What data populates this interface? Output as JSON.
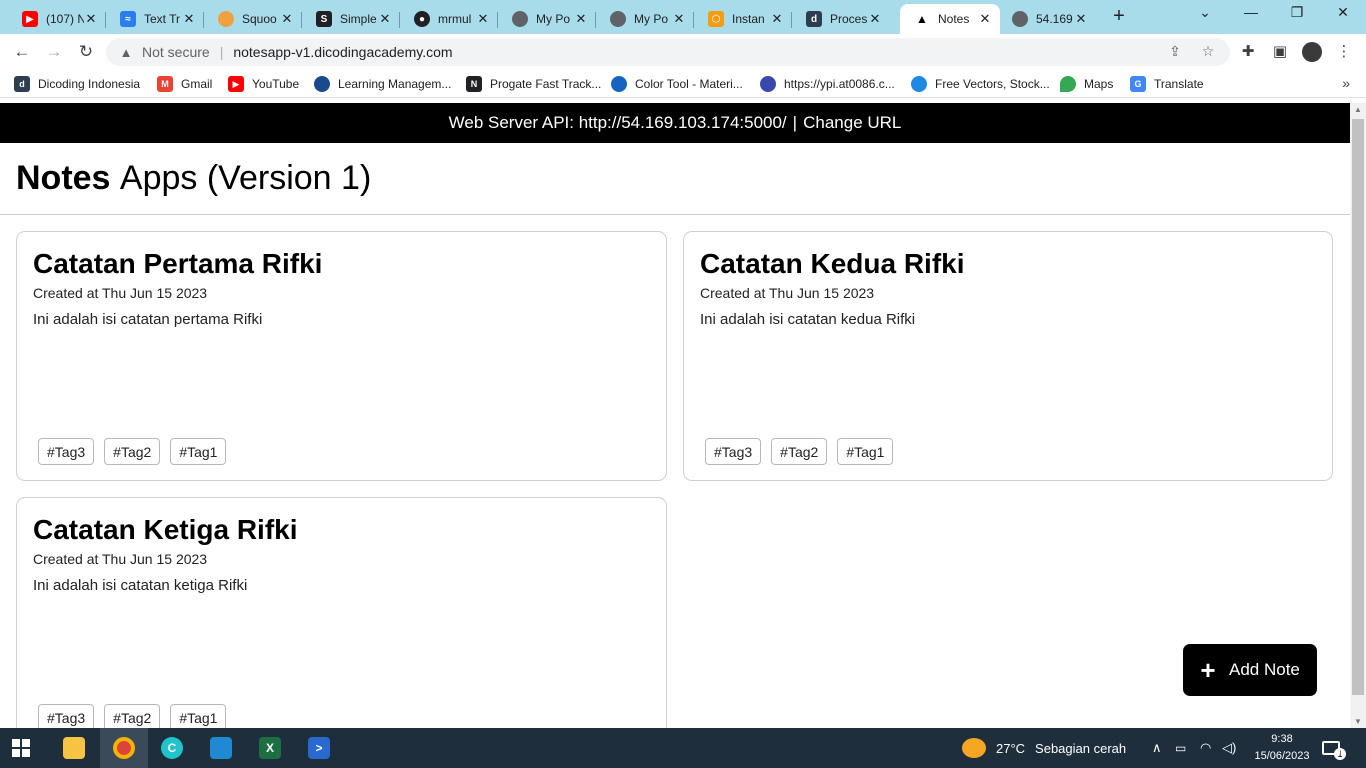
{
  "browser": {
    "tabs": [
      {
        "title": "(107) N",
        "icon": "youtube-icon",
        "color": "#ff0000"
      },
      {
        "title": "Text Tr",
        "icon": "wave-icon",
        "color": "#2b7de9"
      },
      {
        "title": "Squoo",
        "icon": "squoosh-icon",
        "color": "#f0a040"
      },
      {
        "title": "Simple",
        "icon": "simple-icon",
        "color": "#202124"
      },
      {
        "title": "mrmul",
        "icon": "github-icon",
        "color": "#202124"
      },
      {
        "title": "My Po",
        "icon": "globe-icon",
        "color": "#5f6368"
      },
      {
        "title": "My Po",
        "icon": "globe-icon",
        "color": "#5f6368"
      },
      {
        "title": "Instan",
        "icon": "aws-icon",
        "color": "#f39c12"
      },
      {
        "title": "Proces",
        "icon": "dicoding-icon",
        "color": "#2d3e50"
      },
      {
        "title": "Notes",
        "icon": "notes-icon",
        "color": "#000000"
      },
      {
        "title": "54.169",
        "icon": "globe-icon",
        "color": "#5f6368"
      }
    ],
    "new_tab": "+",
    "omnibox": {
      "security": "Not secure",
      "url": "notesapp-v1.dicodingacademy.com"
    },
    "bookmarks": [
      {
        "label": "Dicoding Indonesia",
        "color": "#2d3e50"
      },
      {
        "label": "Gmail",
        "color": "#ea4335"
      },
      {
        "label": "YouTube",
        "color": "#ff0000"
      },
      {
        "label": "Learning Managem...",
        "color": "#1a4a8c"
      },
      {
        "label": "Progate Fast Track...",
        "color": "#202124"
      },
      {
        "label": "Color Tool - Materi...",
        "color": "#1565c0"
      },
      {
        "label": "https://ypi.at0086.c...",
        "color": "#3949ab"
      },
      {
        "label": "Free Vectors, Stock...",
        "color": "#1e88e5"
      },
      {
        "label": "Maps",
        "color": "#34a853"
      },
      {
        "label": "Translate",
        "color": "#4285f4"
      }
    ]
  },
  "page": {
    "api_bar": {
      "text": "Web Server API: http://54.169.103.174:5000/",
      "separator": "|",
      "change_url": "Change URL"
    },
    "title_bold": "Notes",
    "title_rest": "Apps (Version 1)",
    "notes": [
      {
        "title": "Catatan Pertama Rifki",
        "created": "Created at Thu Jun 15 2023",
        "body": "Ini adalah isi catatan pertama Rifki",
        "tags": [
          "#Tag3",
          "#Tag2",
          "#Tag1"
        ]
      },
      {
        "title": "Catatan Kedua Rifki",
        "created": "Created at Thu Jun 15 2023",
        "body": "Ini adalah isi catatan kedua Rifki",
        "tags": [
          "#Tag3",
          "#Tag2",
          "#Tag1"
        ]
      },
      {
        "title": "Catatan Ketiga Rifki",
        "created": "Created at Thu Jun 15 2023",
        "body": "Ini adalah isi catatan ketiga Rifki",
        "tags": [
          "#Tag3",
          "#Tag2",
          "#Tag1"
        ]
      }
    ],
    "add_note": {
      "icon": "+",
      "label": "Add Note"
    }
  },
  "taskbar": {
    "apps": [
      {
        "name": "file-explorer-icon",
        "glyph": "",
        "color": "#f6c343"
      },
      {
        "name": "chrome-icon",
        "glyph": "",
        "color": "#db4437"
      },
      {
        "name": "canva-icon",
        "glyph": "C",
        "color": "#20c4cb"
      },
      {
        "name": "vscode-icon",
        "glyph": "",
        "color": "#1f8ad2"
      },
      {
        "name": "excel-icon",
        "glyph": "X",
        "color": "#1d6f42"
      },
      {
        "name": "powershell-icon",
        "glyph": ">",
        "color": "#2a6acf"
      }
    ],
    "weather": {
      "temp": "27°C",
      "desc": "Sebagian cerah"
    },
    "time": "9:38",
    "date": "15/06/2023",
    "notifications": "1"
  }
}
